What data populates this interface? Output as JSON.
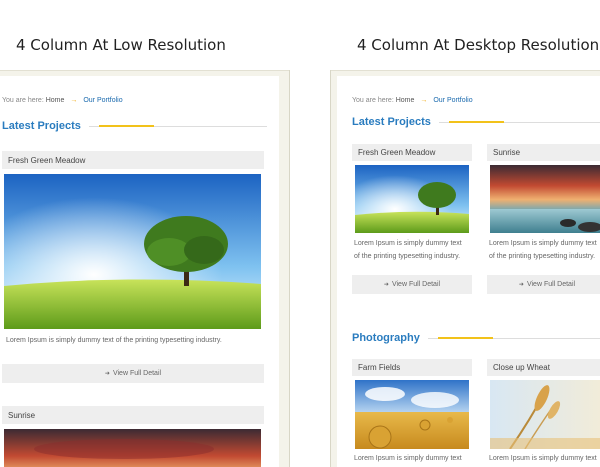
{
  "captions": {
    "low": "4 Column At Low Resolution",
    "desktop": "4 Column At Desktop Resolution"
  },
  "breadcrumb": {
    "prefix": "You are here:",
    "home": "Home",
    "separator": "→",
    "current": "Our Portfolio"
  },
  "sections": {
    "latest": "Latest Projects",
    "photography": "Photography"
  },
  "cards": {
    "meadow": "Fresh Green Meadow",
    "sunrise": "Sunrise",
    "farm": "Farm Fields",
    "wheat": "Close up Wheat"
  },
  "text": {
    "lorem_full": "Lorem Ipsum is simply dummy text of the printing typesetting industry.",
    "lorem_line1": "Lorem Ipsum is simply dummy text",
    "lorem_line2": "of the printing typesetting industry."
  },
  "buttons": {
    "view_detail": "View Full Detail"
  },
  "colors": {
    "accent_blue": "#2a7cbf",
    "accent_yellow": "#f2c21a",
    "frame_beige": "#f4f3ea"
  }
}
